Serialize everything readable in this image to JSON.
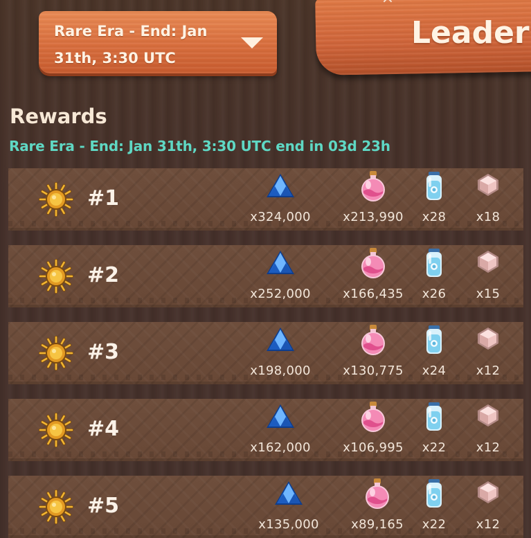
{
  "header": {
    "era_selector_line1": "Rare Era - End: Jan",
    "era_selector_line2": "31th, 3:30 UTC",
    "leaderboard_title": "Leader",
    "close_glyph": "×"
  },
  "rewards": {
    "title": "Rewards",
    "subtitle": "Rare Era - End: Jan 31th, 3:30 UTC end in 03d 23h",
    "rows": [
      {
        "rank": "#1",
        "crystals": "x324,000",
        "potions": "x213,990",
        "bottles": "x28",
        "gems": "x18"
      },
      {
        "rank": "#2",
        "crystals": "x252,000",
        "potions": "x166,435",
        "bottles": "x26",
        "gems": "x15"
      },
      {
        "rank": "#3",
        "crystals": "x198,000",
        "potions": "x130,775",
        "bottles": "x24",
        "gems": "x12"
      },
      {
        "rank": "#4",
        "crystals": "x162,000",
        "potions": "x106,995",
        "bottles": "x22",
        "gems": "x12"
      },
      {
        "rank": "#5",
        "crystals": "x135,000",
        "potions": "x89,165",
        "bottles": "x22",
        "gems": "x12"
      }
    ]
  },
  "icons": {
    "medal": "gold-sun-medal-icon",
    "crystal": "blue-crystal-icon",
    "potion": "pink-potion-icon",
    "bottle": "blue-jar-icon",
    "gem": "pink-gem-icon"
  },
  "colors": {
    "accent_teal": "#5fd8c4",
    "wood_sign": "#d96e3d",
    "row_bg": "#6e4e3c",
    "page_bg": "#45302a"
  }
}
